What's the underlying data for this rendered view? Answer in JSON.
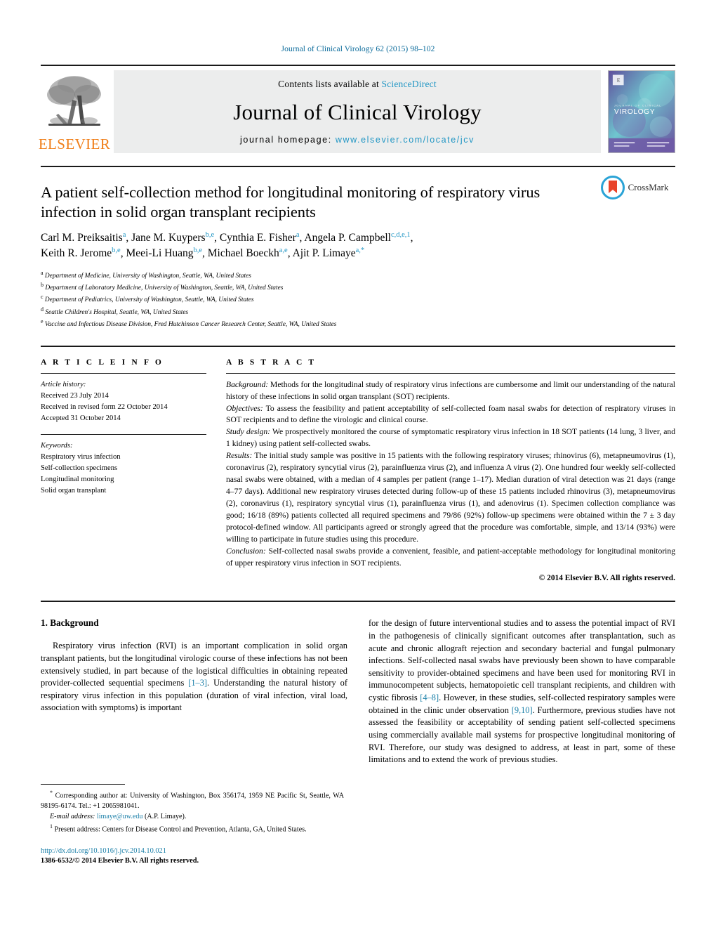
{
  "running_head": "Journal of Clinical Virology 62 (2015) 98–102",
  "masthead": {
    "contents_prefix": "Contents lists available at ",
    "sciencedirect": "ScienceDirect",
    "journal_title": "Journal of Clinical Virology",
    "homepage_prefix": "journal homepage: ",
    "homepage_url": "www.elsevier.com/locate/jcv",
    "publisher_wordmark": "ELSEVIER",
    "cover_title": "VIROLOGY",
    "cover_kicker": "JOURNAL OF CLINICAL",
    "accent_link_color": "#2196c4",
    "elsevier_orange": "#f07f1a"
  },
  "crossmark": {
    "label": "CrossMark"
  },
  "article": {
    "title": "A patient self-collection method for longitudinal monitoring of respiratory virus infection in solid organ transplant recipients",
    "authors_line_1": "Carl M. Preiksaitis<sup>a</sup>, Jane M. Kuypers<sup>b,e</sup>, Cynthia E. Fisher<sup>a</sup>, Angela P. Campbell<sup>c,d,e,1</sup>,",
    "authors_line_2": "Keith R. Jerome<sup>b,e</sup>, Meei-Li Huang<sup>b,e</sup>, Michael Boeckh<sup>a,e</sup>, Ajit P. Limaye<sup>a,</sup><sup>*</sup>",
    "affiliations": [
      {
        "marker": "a",
        "text": "Department of Medicine, University of Washington, Seattle, WA, United States"
      },
      {
        "marker": "b",
        "text": "Department of Laboratory Medicine, University of Washington, Seattle, WA, United States"
      },
      {
        "marker": "c",
        "text": "Department of Pediatrics, University of Washington, Seattle, WA, United States"
      },
      {
        "marker": "d",
        "text": "Seattle Children's Hospital, Seattle, WA, United States"
      },
      {
        "marker": "e",
        "text": "Vaccine and Infectious Disease Division, Fred Hutchinson Cancer Research Center, Seattle, WA, United States"
      }
    ]
  },
  "article_info": {
    "heading": "A R T I C L E   I N F O",
    "history_label": "Article history:",
    "history": [
      "Received 23 July 2014",
      "Received in revised form 22 October 2014",
      "Accepted 31 October 2014"
    ],
    "keywords_label": "Keywords:",
    "keywords": [
      "Respiratory virus infection",
      "Self-collection specimens",
      "Longitudinal monitoring",
      "Solid organ transplant"
    ]
  },
  "abstract": {
    "heading": "A B S T R A C T",
    "background_label": "Background:",
    "background_text": " Methods for the longitudinal study of respiratory virus infections are cumbersome and limit our understanding of the natural history of these infections in solid organ transplant (SOT) recipients.",
    "objectives_label": "Objectives:",
    "objectives_text": " To assess the feasibility and patient acceptability of self-collected foam nasal swabs for detection of respiratory viruses in SOT recipients and to define the virologic and clinical course.",
    "study_design_label": "Study design:",
    "study_design_text": " We prospectively monitored the course of symptomatic respiratory virus infection in 18 SOT patients (14 lung, 3 liver, and 1 kidney) using patient self-collected swabs.",
    "results_label": "Results:",
    "results_text": " The initial study sample was positive in 15 patients with the following respiratory viruses; rhinovirus (6), metapneumovirus (1), coronavirus (2), respiratory syncytial virus (2), parainfluenza virus (2), and influenza A virus (2). One hundred four weekly self-collected nasal swabs were obtained, with a median of 4 samples per patient (range 1–17). Median duration of viral detection was 21 days (range 4–77 days). Additional new respiratory viruses detected during follow-up of these 15 patients included rhinovirus (3), metapneumovirus (2), coronavirus (1), respiratory syncytial virus (1), parainfluenza virus (1), and adenovirus (1). Specimen collection compliance was good; 16/18 (89%) patients collected all required specimens and 79/86 (92%) follow-up specimens were obtained within the 7 ± 3 day protocol-defined window. All participants agreed or strongly agreed that the procedure was comfortable, simple, and 13/14 (93%) were willing to participate in future studies using this procedure.",
    "conclusion_label": "Conclusion:",
    "conclusion_text": " Self-collected nasal swabs provide a convenient, feasible, and patient-acceptable methodology for longitudinal monitoring of upper respiratory virus infection in SOT recipients.",
    "copyright": "© 2014 Elsevier B.V. All rights reserved."
  },
  "body": {
    "section_number_title": "1.  Background",
    "left_paragraph_part1": "Respiratory virus infection (RVI) is an important complication in solid organ transplant patients, but the longitudinal virologic course of these infections has not been extensively studied, in part because of the logistical difficulties in obtaining repeated provider-collected sequential specimens ",
    "left_ref1": "[1–3]",
    "left_paragraph_part2": ". Understanding the natural history of respiratory virus infection in this population (duration of viral infection, viral load, association with symptoms) is important",
    "right_part1": "for the design of future interventional studies and to assess the potential impact of RVI in the pathogenesis of clinically significant outcomes after transplantation, such as acute and chronic allograft rejection and secondary bacterial and fungal pulmonary infections. Self-collected nasal swabs have previously been shown to have comparable sensitivity to provider-obtained specimens and have been used for monitoring RVI in immunocompetent subjects, hematopoietic cell transplant recipients, and children with cystic fibrosis ",
    "right_ref1": "[4–8]",
    "right_part2": ". However, in these studies, self-collected respiratory samples were obtained in the clinic under observation ",
    "right_ref2": "[9,10]",
    "right_part3": ". Furthermore, previous studies have not assessed the feasibility or acceptability of sending patient self-collected specimens using commercially available mail systems for prospective longitudinal monitoring of RVI. Therefore, our study was designed to address, at least in part, some of these limitations and to extend the work of previous studies."
  },
  "footnotes": {
    "corresponding_marker": "*",
    "corresponding_text": " Corresponding author at: University of Washington, Box 356174, 1959 NE Pacific St, Seattle, WA 98195-6174. Tel.: +1 2065981041.",
    "email_label": "E-mail address:",
    "email_address": "limaye@uw.edu",
    "email_suffix": " (A.P. Limaye).",
    "present_marker": "1",
    "present_text": " Present address: Centers for Disease Control and Prevention, Atlanta, GA, United States."
  },
  "footer": {
    "doi_url": "http://dx.doi.org/10.1016/j.jcv.2014.10.021",
    "issn_line": "1386-6532/© 2014 Elsevier B.V. All rights reserved."
  }
}
